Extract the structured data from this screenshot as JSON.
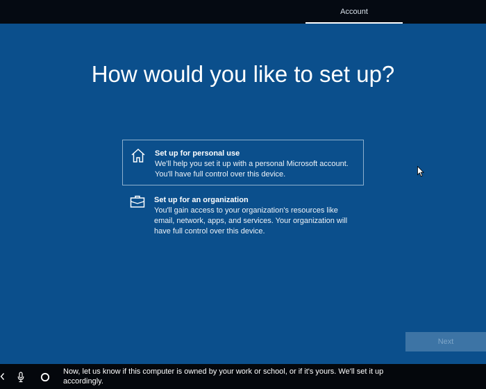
{
  "header": {
    "tabs": [
      {
        "label": "Account",
        "active": true
      }
    ]
  },
  "main": {
    "title": "How would you like to set up?",
    "options": [
      {
        "title": "Set up for personal use",
        "description": "We'll help you set it up with a personal Microsoft account. You'll have full control over this device.",
        "icon": "home-icon",
        "selected": true
      },
      {
        "title": "Set up for an organization",
        "description": "You'll gain access to your organization's resources like email, network, apps, and services. Your organization will have full control over this device.",
        "icon": "briefcase-icon",
        "selected": false
      }
    ],
    "next_label": "Next"
  },
  "taskbar": {
    "narration": "Now, let us know if this computer is owned by your work or school, or if it's yours. We'll set it up accordingly.",
    "icons": [
      "back-chevron-icon",
      "microphone-icon",
      "cortana-circle-icon"
    ]
  },
  "colors": {
    "background": "#0b4f8c",
    "topbar": "#050a12",
    "taskbar": "#04070c",
    "next_button": "#3d74a5"
  }
}
